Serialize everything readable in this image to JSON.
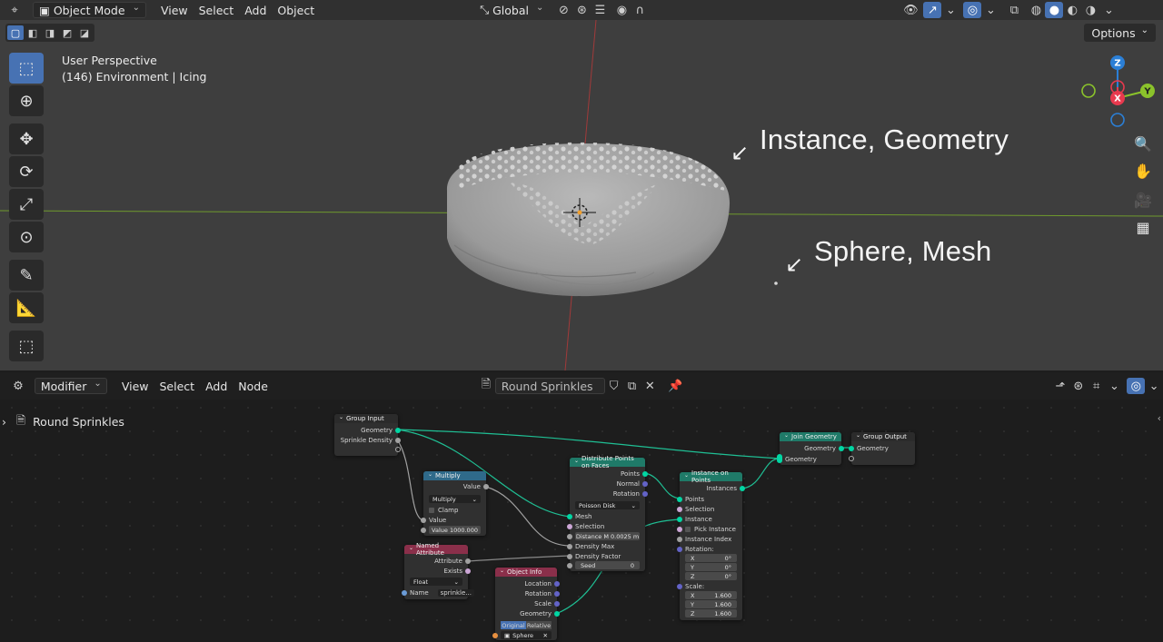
{
  "viewport": {
    "header": {
      "mode": "Object Mode",
      "menus": [
        "View",
        "Select",
        "Add",
        "Object"
      ],
      "orientation": "Global"
    },
    "options_label": "Options",
    "info_line1": "User Perspective",
    "info_line2": "(146) Environment | Icing",
    "annotations": {
      "instance_geometry": "Instance, Geometry",
      "sphere_mesh": "Sphere, Mesh"
    },
    "gizmo": {
      "z": "Z",
      "x": "X",
      "y": "Y"
    },
    "colors": {
      "x_axis": "#e8394e",
      "y_axis": "#8bc32b",
      "z_axis": "#2b7fd6",
      "accent": "#4772b3"
    }
  },
  "node_editor": {
    "header": {
      "editor_type": "Modifier",
      "menus": [
        "View",
        "Select",
        "Add",
        "Node"
      ],
      "tree_name": "Round Sprinkles"
    },
    "breadcrumb": "Round Sprinkles",
    "nodes": {
      "group_input": {
        "title": "Group Input",
        "geometry": "Geometry",
        "sprinkle_density": "Sprinkle Density"
      },
      "multiply": {
        "title": "Multiply",
        "value_out": "Value",
        "op": "Multiply",
        "clamp": "Clamp",
        "value_in": "Value",
        "value_field": "Value  1000.000"
      },
      "named_attribute": {
        "title": "Named Attribute",
        "attribute": "Attribute",
        "exists": "Exists",
        "type": "Float",
        "name_label": "Name",
        "name_value": "sprinkle..."
      },
      "object_info": {
        "title": "Object Info",
        "location": "Location",
        "rotation": "Rotation",
        "scale": "Scale",
        "geometry": "Geometry",
        "original": "Original",
        "relative": "Relative",
        "object": "Sphere"
      },
      "distribute": {
        "title": "Distribute Points on Faces",
        "points": "Points",
        "normal": "Normal",
        "rotation": "Rotation",
        "method": "Poisson Disk",
        "mesh": "Mesh",
        "selection": "Selection",
        "distance": "Distance M   0.0025 m",
        "density_max": "Density Max",
        "density_factor": "Density Factor",
        "seed_label": "Seed",
        "seed_value": "0"
      },
      "instance_on_points": {
        "title": "Instance on Points",
        "instances": "Instances",
        "points": "Points",
        "selection": "Selection",
        "instance": "Instance",
        "pick_instance": "Pick Instance",
        "instance_index": "Instance Index",
        "rotation": "Rotation:",
        "rx": "X",
        "ry": "Y",
        "rz": "Z",
        "rot_val": "0°",
        "scale": "Scale:",
        "sx": "X",
        "sy": "Y",
        "sz": "Z",
        "scale_val": "1.600"
      },
      "join_geometry": {
        "title": "Join Geometry",
        "geometry_out": "Geometry",
        "geometry_in": "Geometry"
      },
      "group_output": {
        "title": "Group Output",
        "geometry": "Geometry"
      }
    }
  }
}
